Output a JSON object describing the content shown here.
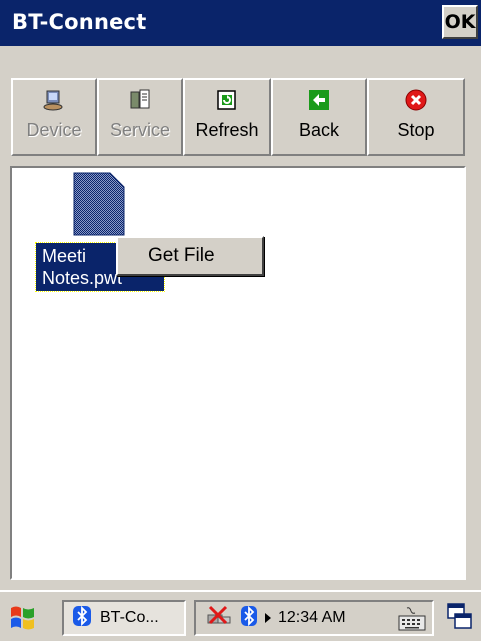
{
  "window": {
    "title": "BT-Connect",
    "ok_label": "OK"
  },
  "toolbar": {
    "buttons": [
      {
        "label": "Device",
        "icon": "device-icon",
        "enabled": false
      },
      {
        "label": "Service",
        "icon": "service-icon",
        "enabled": false
      },
      {
        "label": "Refresh",
        "icon": "refresh-icon",
        "enabled": true
      },
      {
        "label": "Back",
        "icon": "back-arrow-icon",
        "enabled": true
      },
      {
        "label": "Stop",
        "icon": "stop-icon",
        "enabled": true
      }
    ]
  },
  "content": {
    "file": {
      "name_line1": "Meeti",
      "name_line2": "Notes.pwt",
      "icon": "document-icon",
      "selected": true
    },
    "context_menu": {
      "items": [
        "Get File"
      ]
    }
  },
  "taskbar": {
    "start_icon": "windows-start-icon",
    "task_label": "BT-Co...",
    "tray_icons": [
      "network-disconnected-icon",
      "bluetooth-icon",
      "arrow-right-icon"
    ],
    "clock": "12:34 AM",
    "keyboard_icon": "keyboard-icon",
    "switch_icon": "window-switch-icon"
  }
}
